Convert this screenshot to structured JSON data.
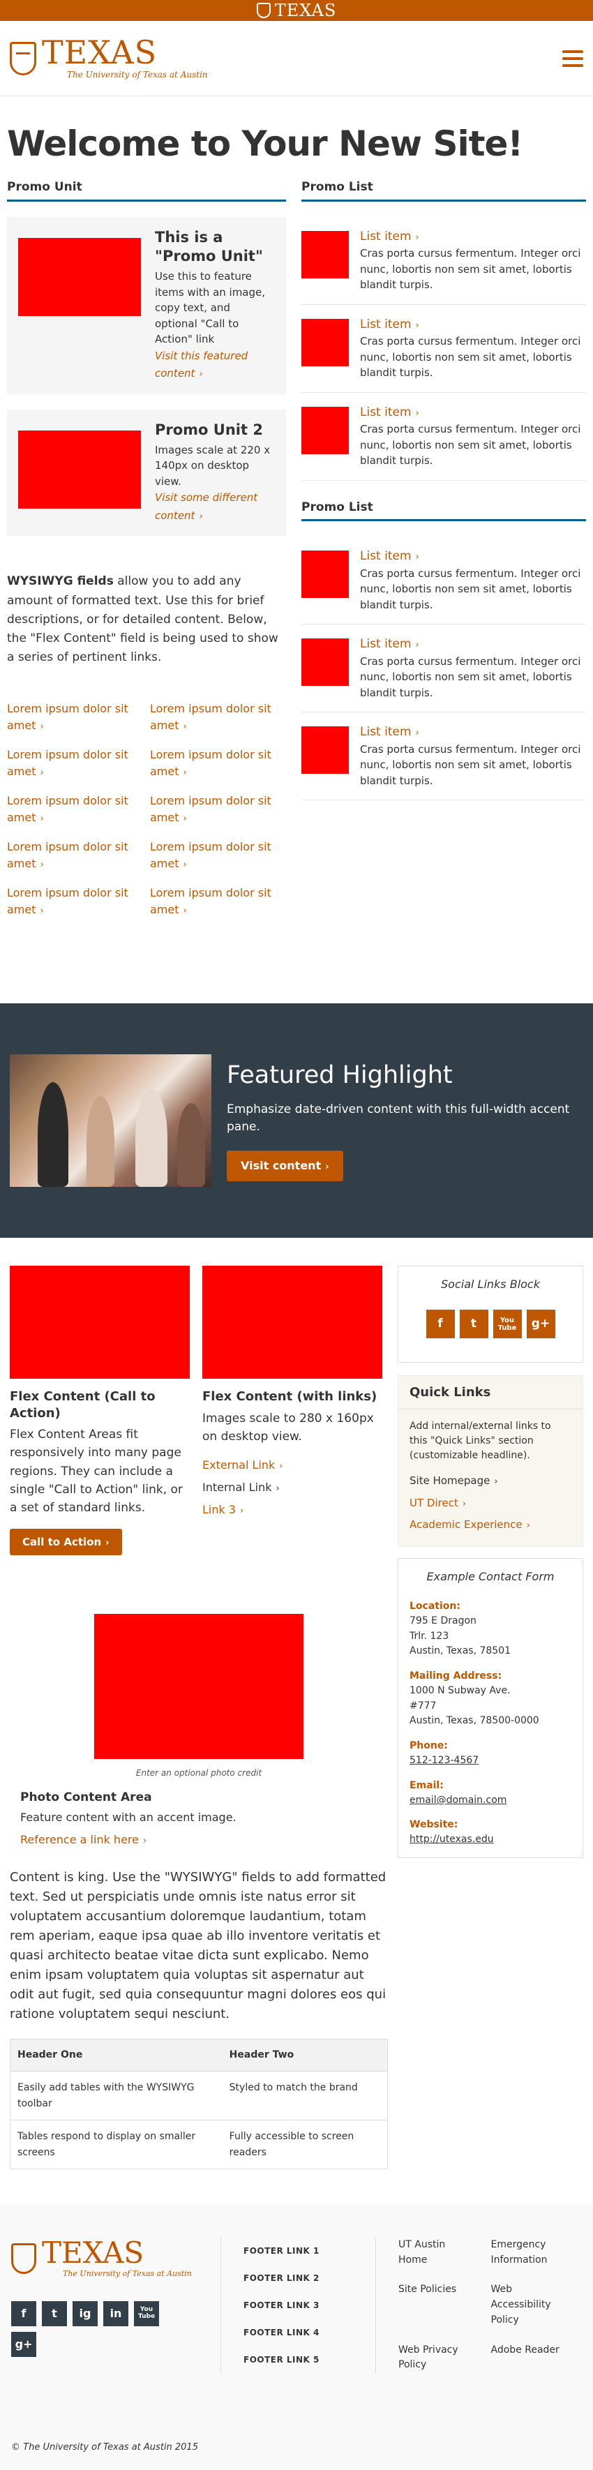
{
  "topbar": {
    "wordmark": "TEXAS"
  },
  "header": {
    "wordmark": "TEXAS",
    "subtitle": "The University of Texas at Austin"
  },
  "page_title": "Welcome to Your New Site!",
  "promo_unit": {
    "heading": "Promo Unit",
    "units": [
      {
        "title": "This is a \"Promo Unit\"",
        "body": "Use this to feature items with an image, copy text, and optional \"Call to Action\" link",
        "link": "Visit this featured content"
      },
      {
        "title": "Promo Unit 2",
        "body": "Images scale at 220 x 140px on desktop view.",
        "link": "Visit some different content"
      }
    ]
  },
  "wysiwyg_intro": {
    "bold": "WYSIWYG fields",
    "text": " allow you to add any amount of formatted text. Use this for brief descriptions, or for detailed content. Below, the \"Flex Content\" field is being used to show a series of pertinent links."
  },
  "lorem_links": [
    "Lorem ipsum dolor sit amet",
    "Lorem ipsum dolor sit amet",
    "Lorem ipsum dolor sit amet",
    "Lorem ipsum dolor sit amet",
    "Lorem ipsum dolor sit amet",
    "Lorem ipsum dolor sit amet",
    "Lorem ipsum dolor sit amet",
    "Lorem ipsum dolor sit amet",
    "Lorem ipsum dolor sit amet",
    "Lorem ipsum dolor sit amet"
  ],
  "promo_lists": [
    {
      "heading": "Promo List",
      "items": [
        {
          "link": "List item",
          "body": "Cras porta cursus fermentum. Integer orci nunc, lobortis non sem sit amet, lobortis blandit turpis."
        },
        {
          "link": "List item",
          "body": "Cras porta cursus fermentum. Integer orci nunc, lobortis non sem sit amet, lobortis blandit turpis."
        },
        {
          "link": "List item",
          "body": "Cras porta cursus fermentum. Integer orci nunc, lobortis non sem sit amet, lobortis blandit turpis."
        }
      ]
    },
    {
      "heading": "Promo List",
      "items": [
        {
          "link": "List item",
          "body": "Cras porta cursus fermentum. Integer orci nunc, lobortis non sem sit amet, lobortis blandit turpis."
        },
        {
          "link": "List item",
          "body": "Cras porta cursus fermentum. Integer orci nunc, lobortis non sem sit amet, lobortis blandit turpis."
        },
        {
          "link": "List item",
          "body": "Cras porta cursus fermentum. Integer orci nunc, lobortis non sem sit amet, lobortis blandit turpis."
        }
      ]
    }
  ],
  "featured": {
    "title": "Featured Highlight",
    "body": "Emphasize date-driven content with this full-width accent pane.",
    "button": "Visit content"
  },
  "flex_cta": {
    "title": "Flex Content (Call to Action)",
    "body": "Flex Content Areas fit responsively into many page regions. They can include a single \"Call to Action\" link, or a set of standard links.",
    "button": "Call to Action"
  },
  "flex_links": {
    "title": "Flex Content (with links)",
    "body": "Images scale to 280 x 160px on desktop view.",
    "links": [
      "External Link",
      "Internal Link",
      "Link 3"
    ]
  },
  "photo_area": {
    "credit": "Enter an optional photo credit",
    "title": "Photo Content Area",
    "body": "Feature content with an accent image.",
    "link": "Reference a link here"
  },
  "content_text": "Content is king. Use the \"WYSIWYG\" fields to add formatted text. Sed ut perspiciatis unde omnis iste natus error sit voluptatem accusantium doloremque laudantium, totam rem aperiam, eaque ipsa quae ab illo inventore veritatis et quasi architecto beatae vitae dicta sunt explicabo. Nemo enim ipsam voluptatem quia voluptas sit aspernatur aut odit aut fugit, sed quia consequuntur magni dolores eos qui ratione voluptatem sequi nesciunt.",
  "table": {
    "headers": [
      "Header One",
      "Header Two"
    ],
    "rows": [
      [
        "Easily add tables with the WYSIWYG toolbar",
        "Styled to match the brand"
      ],
      [
        "Tables respond to display on smaller screens",
        "Fully accessible to screen readers"
      ]
    ]
  },
  "social_block": {
    "title": "Social Links Block",
    "icons": [
      "f",
      "t",
      "You Tube",
      "g+"
    ]
  },
  "quick_links": {
    "title": "Quick Links",
    "body": "Add internal/external links to this \"Quick Links\" section (customizable headline).",
    "links": [
      "Site Homepage",
      "UT Direct",
      "Academic Experience"
    ]
  },
  "contact_form": {
    "title": "Example Contact Form",
    "location_label": "Location:",
    "location": [
      "795 E Dragon",
      "Trlr. 123",
      "Austin, Texas, 78501"
    ],
    "mailing_label": "Mailing Address:",
    "mailing": [
      "1000 N Subway Ave.",
      "#777",
      "Austin, Texas, 78500-0000"
    ],
    "phone_label": "Phone:",
    "phone": "512-123-4567",
    "email_label": "Email:",
    "email": "email@domain.com",
    "website_label": "Website:",
    "website": "http://utexas.edu"
  },
  "footer": {
    "wordmark": "TEXAS",
    "subtitle": "The University of Texas at Austin",
    "social": [
      "f",
      "t",
      "ig",
      "in",
      "You Tube",
      "g+"
    ],
    "links": [
      "FOOTER LINK 1",
      "FOOTER LINK 2",
      "FOOTER LINK 3",
      "FOOTER LINK 4",
      "FOOTER LINK 5"
    ],
    "util_links": [
      "UT Austin Home",
      "Emergency Information",
      "Site Policies",
      "Web Accessibility Policy",
      "Web Privacy Policy",
      "Adobe Reader"
    ],
    "copyright": "© The University of Texas at Austin 2015"
  },
  "colors": {
    "burnt_orange": "#bf5700",
    "charcoal": "#333f48",
    "placeholder_red": "#ff0000",
    "accent_blue": "#005f86"
  }
}
